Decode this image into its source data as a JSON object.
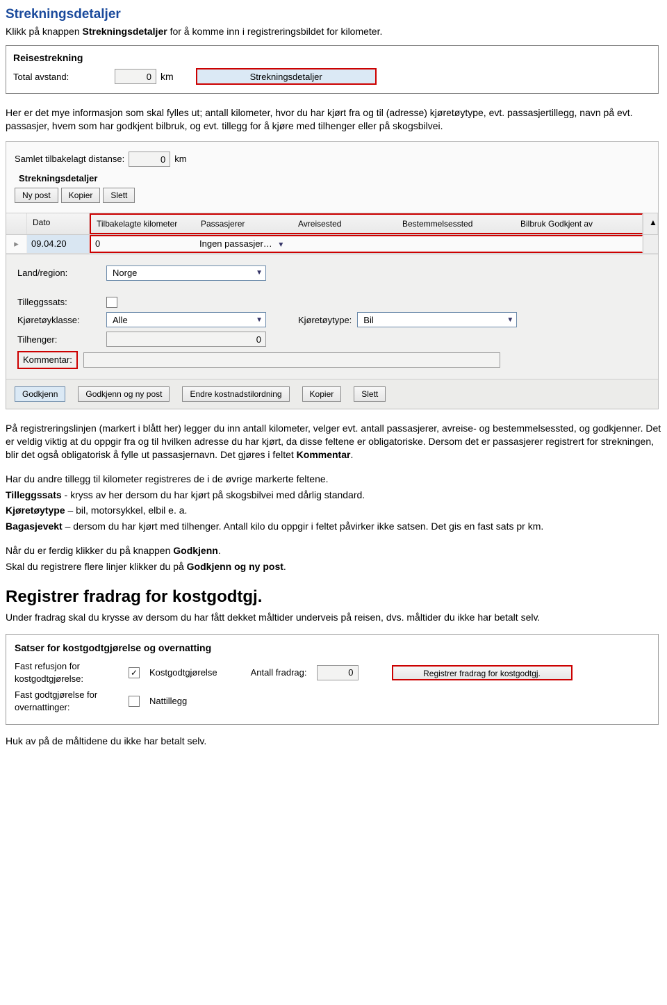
{
  "header": {
    "title": "Strekningsdetaljer",
    "intro_prefix": "Klikk på knappen ",
    "intro_bold": "Strekningsdetaljer",
    "intro_suffix": " for å komme inn i registreringsbildet for kilometer."
  },
  "panel1": {
    "title": "Reisestrekning",
    "total_label": "Total avstand:",
    "total_value": "0",
    "unit": "km",
    "button": "Strekningsdetaljer"
  },
  "para_between": "Her er det mye informasjon som skal fylles ut; antall kilometer, hvor du har kjørt fra og til (adresse) kjøretøytype, evt. passasjertillegg, navn på evt. passasjer, hvem som har godkjent bilbruk, og evt. tillegg for å kjøre med tilhenger eller på skogsbilvei.",
  "panel2": {
    "distance_label": "Samlet tilbakelagt distanse:",
    "distance_value": "0",
    "distance_unit": "km",
    "section_title": "Strekningsdetaljer",
    "toolbar": {
      "new": "Ny post",
      "copy": "Kopier",
      "delete": "Slett"
    },
    "grid": {
      "headers": {
        "star": "",
        "date": "Dato",
        "km": "Tilbakelagte kilometer",
        "pass": "Passasjerer",
        "avr": "Avreisested",
        "best": "Bestemmelsessted",
        "bil": "Bilbruk Godkjent av"
      },
      "row": {
        "date": "09.04.20",
        "km": "0",
        "pass": "Ingen passasjer…"
      }
    },
    "form": {
      "land_label": "Land/region:",
      "land_value": "Norge",
      "tilleggssats_label": "Tilleggssats:",
      "klasse_label": "Kjøretøyklasse:",
      "klasse_value": "Alle",
      "type_label": "Kjøretøytype:",
      "type_value": "Bil",
      "tilhenger_label": "Tilhenger:",
      "tilhenger_value": "0",
      "kommentar_label": "Kommentar:"
    },
    "footer": {
      "godkjenn": "Godkjenn",
      "godkjenn_ny": "Godkjenn og ny post",
      "endre": "Endre kostnadstilordning",
      "kopier": "Kopier",
      "slett": "Slett"
    }
  },
  "body_text": {
    "p1_prefix": "På registreringslinjen (markert i blått her) legger du inn antall kilometer, velger evt. antall passasjerer, avreise- og bestemmelsessted, og godkjenner. Det er veldig viktig at du oppgir fra og til hvilken adresse du har kjørt, da disse feltene er obligatoriske. Dersom det er passasjerer registrert for strekningen, blir det også obligatorisk å fylle ut passasjernavn. Det gjøres i feltet ",
    "p1_bold": "Kommentar",
    "p1_suffix": ".",
    "p2_l1": "Har du andre tillegg til kilometer registreres de i de øvrige markerte feltene.",
    "p2_l2_bold": "Tilleggssats",
    "p2_l2_rest": " - kryss av her dersom du har kjørt på skogsbilvei med dårlig standard.",
    "p2_l3_bold": "Kjøretøytype",
    "p2_l3_rest": " – bil, motorsykkel, elbil e. a.",
    "p2_l4_bold": "Bagasjevekt",
    "p2_l4_rest": " – dersom du har kjørt med tilhenger. Antall kilo du oppgir i feltet påvirker ikke satsen. Det gis en fast sats pr km.",
    "p3_l1_pre": "Når du er ferdig klikker du på knappen ",
    "p3_l1_bold": "Godkjenn",
    "p3_l1_post": ".",
    "p3_l2_pre": "Skal du registrere flere linjer klikker du på ",
    "p3_l2_bold": "Godkjenn og ny post",
    "p3_l2_post": "."
  },
  "section2": {
    "title": "Registrer fradrag for kostgodtgj.",
    "intro": "Under fradrag skal du krysse av dersom du har fått dekket måltider underveis på reisen, dvs. måltider du ikke har betalt selv."
  },
  "panel3": {
    "title": "Satser for kostgodtgjørelse og overnatting",
    "row1_label": "Fast refusjon for kostgodtgjørelse:",
    "row1_cb": "Kostgodtgjørelse",
    "row1_antall_label": "Antall fradrag:",
    "row1_antall_value": "0",
    "row1_button": "Registrer fradrag for kostgodtgj.",
    "row2_label": "Fast godtgjørelse for overnattinger:",
    "row2_cb": "Nattillegg"
  },
  "footer_text": "Huk av på de måltidene du ikke har betalt selv."
}
